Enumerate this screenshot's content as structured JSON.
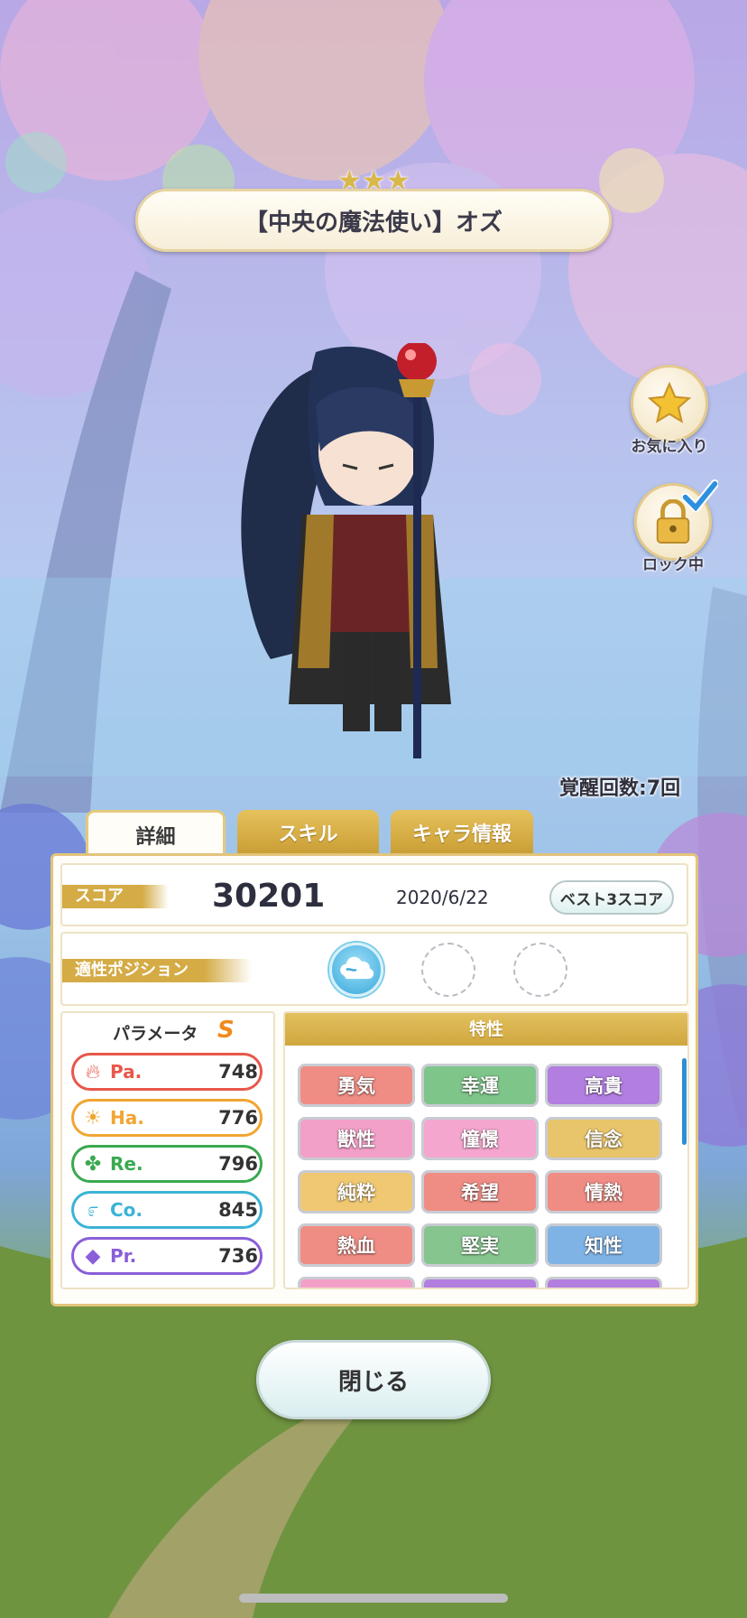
{
  "card": {
    "rarity_stars": "★★★",
    "title": "【中央の魔法使い】オズ"
  },
  "side": {
    "favorite_label": "お気に入り",
    "lock_label": "ロック中"
  },
  "awaken_text": "覚醒回数:7回",
  "tabs": [
    {
      "label": "詳細",
      "active": true
    },
    {
      "label": "スキル",
      "active": false
    },
    {
      "label": "キャラ情報",
      "active": false
    }
  ],
  "score": {
    "label": "スコア",
    "value": "30201",
    "date": "2020/6/22",
    "best_button": "ベスト3スコア"
  },
  "position": {
    "label": "適性ポジション"
  },
  "params": {
    "title": "パラメータ",
    "rank": "S",
    "stats": [
      {
        "name": "Pa.",
        "value": "748",
        "color": "#e8574a",
        "icon": "flame-icon"
      },
      {
        "name": "Ha.",
        "value": "776",
        "color": "#f1a532",
        "icon": "sun-icon"
      },
      {
        "name": "Re.",
        "value": "796",
        "color": "#3aa94f",
        "icon": "clover-icon"
      },
      {
        "name": "Co.",
        "value": "845",
        "color": "#3bb3d6",
        "icon": "swirl-icon"
      },
      {
        "name": "Pr.",
        "value": "736",
        "color": "#8a5fd8",
        "icon": "diamond-icon"
      }
    ]
  },
  "traits": {
    "title": "特性",
    "items": [
      {
        "label": "勇気",
        "color": "#ef8d84"
      },
      {
        "label": "幸運",
        "color": "#7ec58a"
      },
      {
        "label": "高貴",
        "color": "#b27ee0"
      },
      {
        "label": "獣性",
        "color": "#f2a0c8"
      },
      {
        "label": "憧憬",
        "color": "#f4a6cf"
      },
      {
        "label": "信念",
        "color": "#e8c46a"
      },
      {
        "label": "純粋",
        "color": "#f0c872"
      },
      {
        "label": "希望",
        "color": "#ef8d84"
      },
      {
        "label": "情熱",
        "color": "#ef8d84"
      },
      {
        "label": "熱血",
        "color": "#ef8d84"
      },
      {
        "label": "堅実",
        "color": "#86c68e"
      },
      {
        "label": "知性",
        "color": "#7fb3e6"
      }
    ]
  },
  "close_button": "閉じる"
}
